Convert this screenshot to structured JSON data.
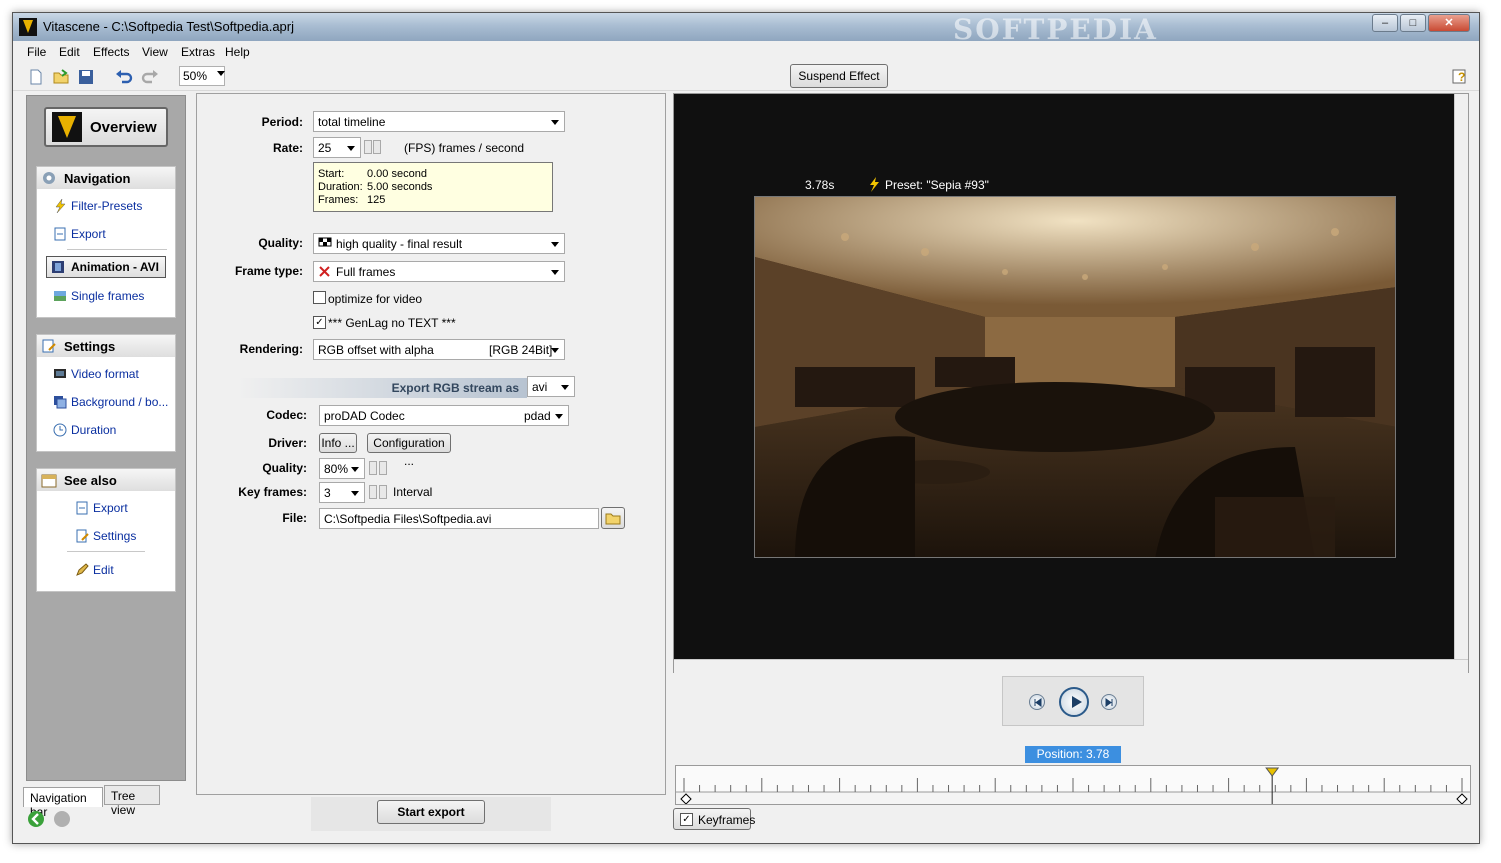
{
  "window": {
    "title": "Vitascene - C:\\Softpedia Test\\Softpedia.aprj",
    "watermark": "SOFTPEDIA",
    "controls": {
      "minimize": "–",
      "maximize": "□",
      "close": "✕"
    }
  },
  "menu": [
    "File",
    "Edit",
    "Effects",
    "View",
    "Extras",
    "Help"
  ],
  "toolbar": {
    "zoom": "50%",
    "suspend_label": "Suspend Effect"
  },
  "sidebar": {
    "overview_label": "Overview",
    "navigation": {
      "title": "Navigation",
      "items": [
        "Filter-Presets",
        "Export",
        "Animation - AVI",
        "Single frames"
      ]
    },
    "settings": {
      "title": "Settings",
      "items": [
        "Video format",
        "Background / bo...",
        "Duration"
      ]
    },
    "see_also": {
      "title": "See also",
      "items": [
        "Export",
        "Settings",
        "Edit"
      ]
    },
    "tabs": [
      "Navigation bar",
      "Tree view"
    ]
  },
  "form": {
    "period_label": "Period:",
    "period_value": "total timeline",
    "rate_label": "Rate:",
    "rate_value": "25",
    "rate_unit": "(FPS) frames / second",
    "info": {
      "start_key": "Start:",
      "start_val": "0.00 second",
      "duration_key": "Duration:",
      "duration_val": "5.00 seconds",
      "frames_key": "Frames:",
      "frames_val": "125"
    },
    "quality_label": "Quality:",
    "quality_value": "high quality - final result",
    "frametype_label": "Frame type:",
    "frametype_value": "Full frames",
    "optimize_label": "optimize for video",
    "genlag_label": "*** GenLag no TEXT ***",
    "rendering_label": "Rendering:",
    "rendering_value": "RGB offset with alpha",
    "rendering_mode": "[RGB 24Bit]",
    "export_stream_label": "Export RGB stream as",
    "export_stream_value": "avi",
    "codec_label": "Codec:",
    "codec_value": "proDAD Codec",
    "codec_fourcc": "pdad",
    "driver_label": "Driver:",
    "info_button": "Info ...",
    "config_button": "Configuration ...",
    "quality2_label": "Quality:",
    "quality2_value": "80%",
    "keyframes_label": "Key frames:",
    "keyframes_value": "3",
    "keyframes_unit": "Interval",
    "file_label": "File:",
    "file_value": "C:\\Softpedia Files\\Softpedia.avi",
    "start_export": "Start export"
  },
  "preview": {
    "time": "3.78s",
    "preset": "Preset: \"Sepia #93\""
  },
  "timeline": {
    "position": "Position: 3.78 sec.",
    "position_fraction": 0.756,
    "keyframes_label": "Keyframes"
  },
  "colors": {
    "accent": "#3c8fe0",
    "marker": "#e8c100"
  }
}
